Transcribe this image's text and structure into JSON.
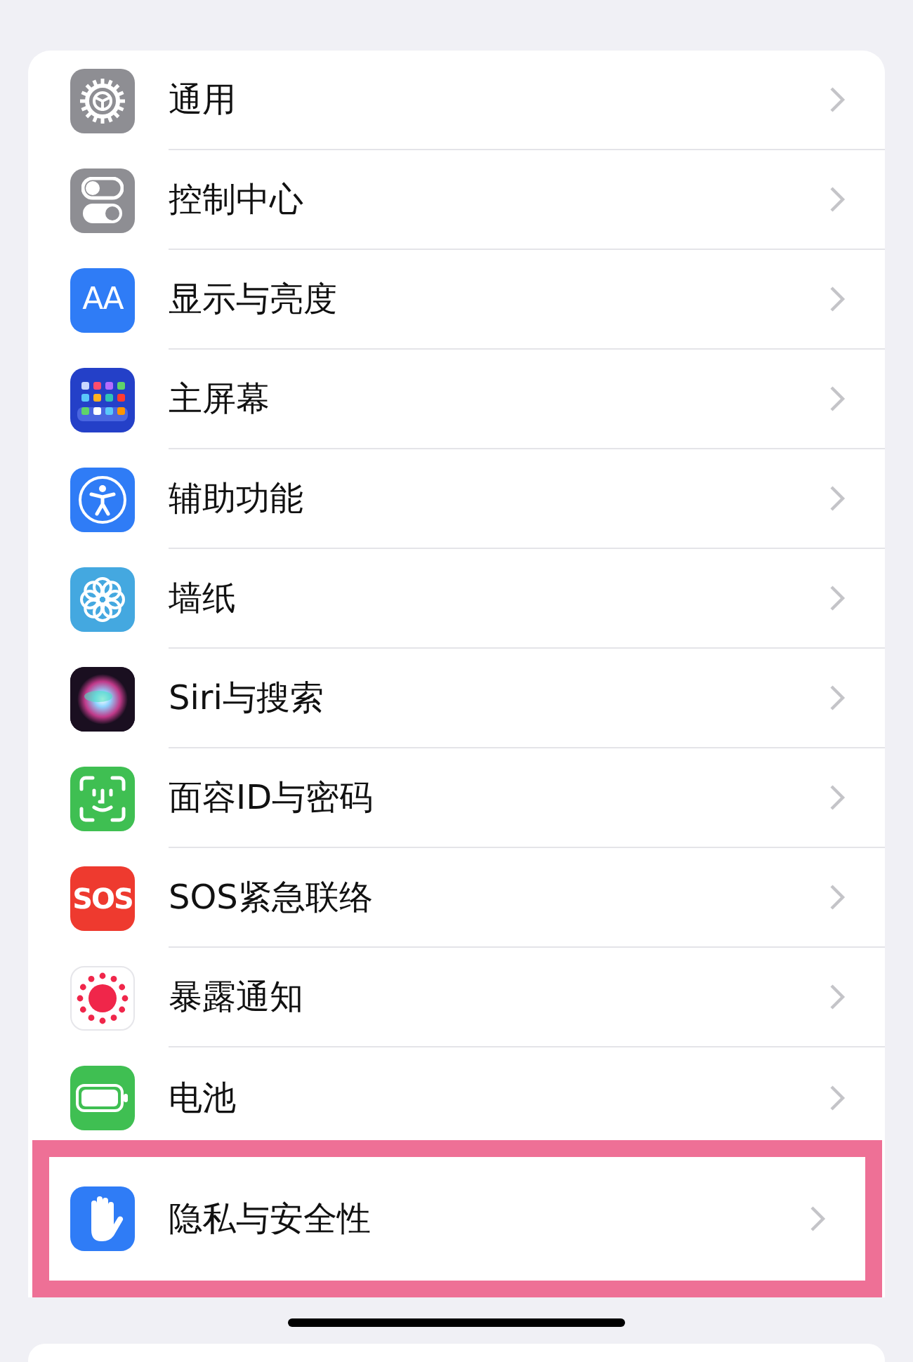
{
  "settings": [
    {
      "label": "通用",
      "kind": "gear",
      "highlighted": false
    },
    {
      "label": "控制中心",
      "kind": "toggles",
      "highlighted": false
    },
    {
      "label": "显示与亮度",
      "kind": "textsize",
      "icon_text": "AA",
      "highlighted": false
    },
    {
      "label": "主屏幕",
      "kind": "homegrid",
      "highlighted": false
    },
    {
      "label": "辅助功能",
      "kind": "accessibility",
      "highlighted": false
    },
    {
      "label": "墙纸",
      "kind": "flower",
      "highlighted": false
    },
    {
      "label": "Siri与搜索",
      "kind": "siri",
      "highlighted": false
    },
    {
      "label": "面容ID与密码",
      "kind": "faceid",
      "highlighted": false
    },
    {
      "label": "SOS紧急联络",
      "kind": "sos",
      "icon_text": "SOS",
      "highlighted": false
    },
    {
      "label": "暴露通知",
      "kind": "exposure",
      "highlighted": false
    },
    {
      "label": "电池",
      "kind": "battery",
      "highlighted": false
    },
    {
      "label": "隐私与安全性",
      "kind": "hand",
      "highlighted": true
    }
  ]
}
